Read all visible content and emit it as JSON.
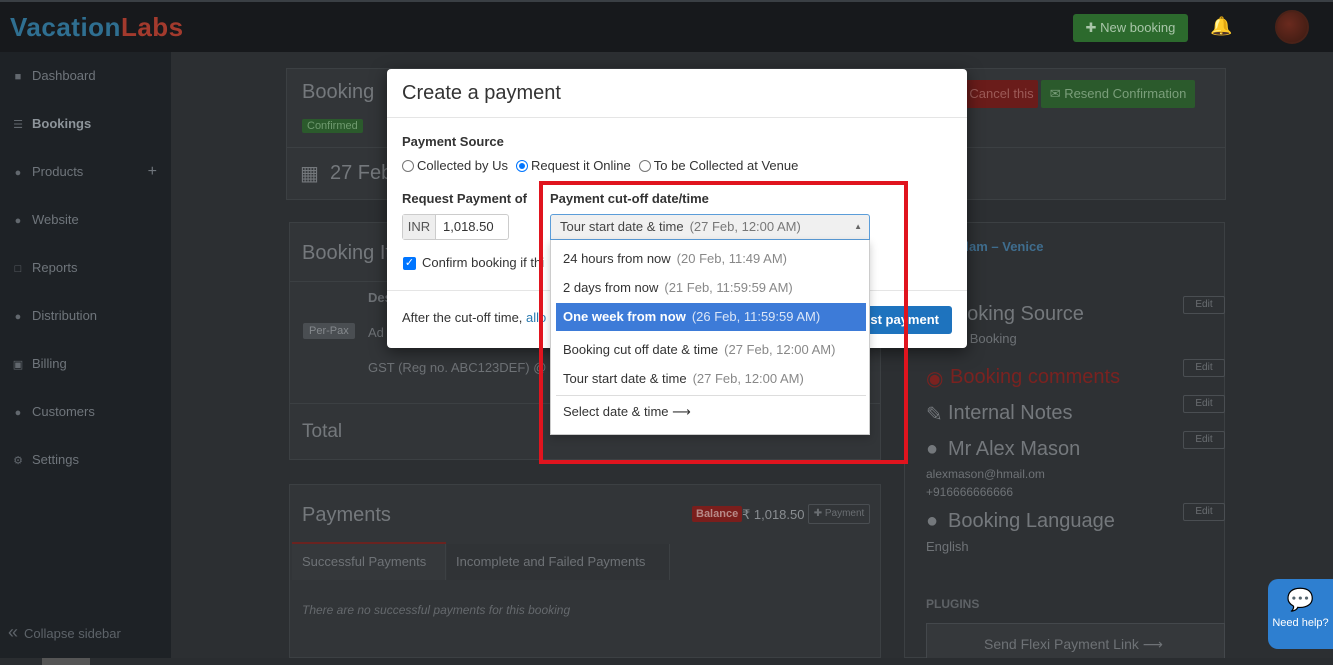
{
  "app": {
    "logo_part1": "Vacation",
    "logo_part2": "Labs",
    "new_booking_label": "✚ New booking"
  },
  "sidebar": {
    "items": [
      {
        "label": "Dashboard",
        "icon": "tachometer-icon"
      },
      {
        "label": "Bookings",
        "icon": "list-icon"
      },
      {
        "label": "Products",
        "icon": "map-marker-icon"
      },
      {
        "label": "Website",
        "icon": "globe-icon"
      },
      {
        "label": "Reports",
        "icon": "file-chart-icon"
      },
      {
        "label": "Distribution",
        "icon": "users-icon"
      },
      {
        "label": "Billing",
        "icon": "money-icon"
      },
      {
        "label": "Customers",
        "icon": "user-icon"
      },
      {
        "label": "Settings",
        "icon": "gear-icon"
      }
    ],
    "collapse_label": "Collapse sidebar"
  },
  "background": {
    "booking_title": "Booking",
    "status_badge": "Confirmed",
    "cancel_label": "Cancel this",
    "resend_label": "✉ Resend Confirmation",
    "date_text": "27 Feb",
    "booking_items_title": "Booking It",
    "desc_header": "Des",
    "pax_badge": "Per-Pax",
    "row_ad": "Ad",
    "gst_text": "GST (Reg no. ABC123DEF) @",
    "total_label": "Total",
    "payments_title": "Payments",
    "balance_badge": "Balance",
    "balance_amount": "₹ 1,018.50",
    "add_payment_label": "✚ Payment",
    "tab_successful": "Successful Payments",
    "tab_incomplete": "Incomplete and Failed Payments",
    "no_payments_text": "There are no successful payments for this booking",
    "tour_name_fragment": "rdam – Venice",
    "booking_source_title": "ooking Source",
    "booking_source_value": "ct Booking",
    "booking_comments_title": "Booking comments",
    "internal_notes_title": "Internal Notes",
    "customer_name": "Mr Alex Mason",
    "customer_email": "alexmason@hmail.om",
    "customer_phone": "+916666666666",
    "language_title": "Booking Language",
    "language_value": "English",
    "plugins_title": "PLUGINS",
    "flexi_link_label": "Send Flexi Payment Link ⟶",
    "edit_label": "Edit",
    "need_help": "Need help?"
  },
  "modal": {
    "title": "Create a payment",
    "payment_source_label": "Payment Source",
    "payment_source_options": [
      {
        "label": "Collected by Us",
        "selected": false
      },
      {
        "label": "Request it Online",
        "selected": true
      },
      {
        "label": "To be Collected at Venue",
        "selected": false
      }
    ],
    "request_payment_label": "Request Payment of",
    "currency": "INR",
    "amount": "1,018.50",
    "confirm_booking_label": "Confirm booking if thi",
    "confirm_booking_checked": true,
    "cutoff_label": "Payment cut-off date/time",
    "after_cutoff_text": "After the cut-off time,",
    "after_cutoff_link": "allo",
    "request_button": "est payment"
  },
  "cutoff_select": {
    "value_label": "Tour start date & time",
    "value_sub": "(27 Feb, 12:00 AM)",
    "options": [
      {
        "label": "24 hours from now",
        "sub": "(20 Feb, 11:49 AM)",
        "selected": false
      },
      {
        "label": "2 days from now",
        "sub": "(21 Feb, 11:59:59 AM)",
        "selected": false
      },
      {
        "label": "One week from now",
        "sub": "(26 Feb, 11:59:59 AM)",
        "selected": true
      },
      {
        "label": "Booking cut off date & time",
        "sub": "(27 Feb, 12:00 AM)",
        "selected": false
      },
      {
        "label": "Tour start date & time",
        "sub": "(27 Feb, 12:00 AM)",
        "selected": false
      }
    ],
    "custom_option": "Select date & time ⟶"
  },
  "colors": {
    "highlight_border": "#e0141e",
    "selected_option_bg": "#3d7bd8",
    "primary_button": "#1e73be"
  }
}
